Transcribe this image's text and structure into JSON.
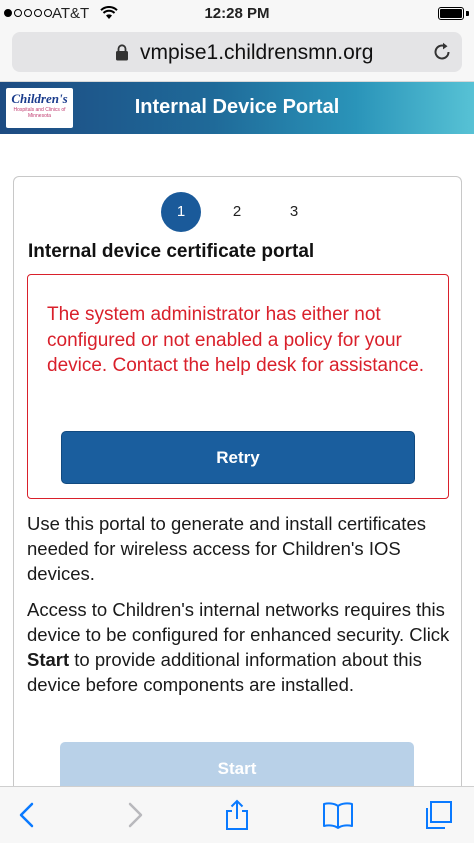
{
  "status_bar": {
    "carrier": "AT&T",
    "time": "12:28 PM"
  },
  "browser": {
    "url": "vmpise1.childrensmn.org"
  },
  "banner": {
    "logo_text": "Children's",
    "logo_subtext": "Hospitals and Clinics of Minnesota",
    "title": "Internal Device Portal"
  },
  "steps": [
    {
      "label": "1",
      "active": true
    },
    {
      "label": "2",
      "active": false
    },
    {
      "label": "3",
      "active": false
    }
  ],
  "page": {
    "title": "Internal device certificate portal",
    "error_message": "The system administrator has either not configured or not enabled a policy for your device. Contact the help desk for assistance.",
    "retry_label": "Retry",
    "intro": "Use this portal to generate and install certificates needed for wireless access for Children's IOS devices.",
    "access_before": "Access to Children's internal networks requires this device to be configured for enhanced security. Click ",
    "access_bold": "Start",
    "access_after": " to provide additional information about this device before components are installed.",
    "start_label": "Start"
  },
  "colors": {
    "accent": "#1a5e9e",
    "error": "#d9202b",
    "ios_blue": "#0a7aff"
  },
  "toolbar": {
    "icons": [
      "back-icon",
      "forward-icon",
      "share-icon",
      "bookmarks-icon",
      "tabs-icon"
    ]
  }
}
